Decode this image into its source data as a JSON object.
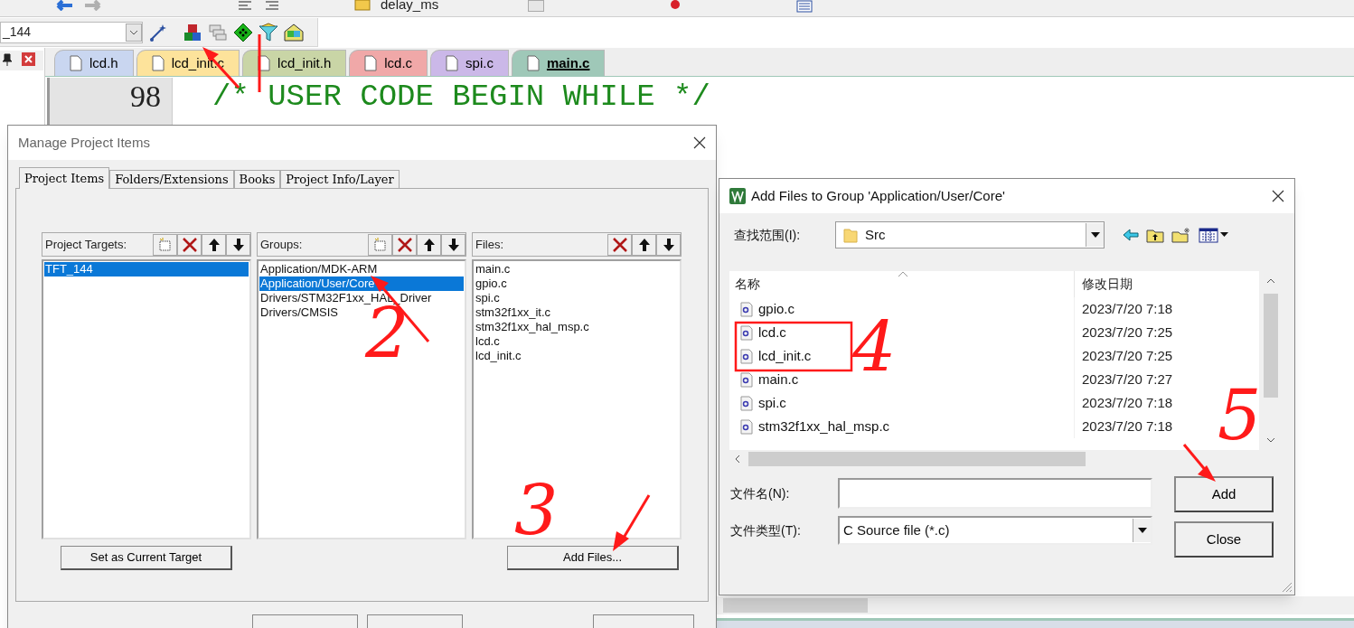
{
  "toolbar": {
    "function_box": "delay_ms",
    "target_box": "_144"
  },
  "tabs": [
    {
      "label": "lcd.h",
      "color": "#c9d6f0",
      "selected": false
    },
    {
      "label": "lcd_init.c",
      "color": "#fde39b",
      "selected": false
    },
    {
      "label": "lcd_init.h",
      "color": "#c9d5a6",
      "selected": false
    },
    {
      "label": "lcd.c",
      "color": "#f0a8a8",
      "selected": false
    },
    {
      "label": "spi.c",
      "color": "#cbb8e8",
      "selected": false
    },
    {
      "label": "main.c",
      "color": "#9fc8b8",
      "selected": true
    }
  ],
  "editor": {
    "lines": [
      {
        "number": "98",
        "code": "/* USER CODE BEGIN WHILE */",
        "kind": "comment"
      }
    ]
  },
  "manage_dialog": {
    "title": "Manage Project Items",
    "tabs": [
      {
        "label": "Project Items",
        "selected": true
      },
      {
        "label": "Folders/Extensions",
        "selected": false
      },
      {
        "label": "Books",
        "selected": false
      },
      {
        "label": "Project Info/Layer",
        "selected": false
      }
    ],
    "panels": [
      {
        "label": "Project Targets:",
        "has_new": true,
        "items": [
          {
            "label": "TFT_144",
            "selected": true
          }
        ]
      },
      {
        "label": "Groups:",
        "has_new": true,
        "items": [
          {
            "label": "Application/MDK-ARM",
            "selected": false
          },
          {
            "label": "Application/User/Core",
            "selected": true
          },
          {
            "label": "Drivers/STM32F1xx_HAL_Driver",
            "selected": false
          },
          {
            "label": "Drivers/CMSIS",
            "selected": false
          }
        ]
      },
      {
        "label": "Files:",
        "has_new": false,
        "items": [
          {
            "label": "main.c",
            "selected": false
          },
          {
            "label": "gpio.c",
            "selected": false
          },
          {
            "label": "spi.c",
            "selected": false
          },
          {
            "label": "stm32f1xx_it.c",
            "selected": false
          },
          {
            "label": "stm32f1xx_hal_msp.c",
            "selected": false
          },
          {
            "label": "lcd.c",
            "selected": false
          },
          {
            "label": "lcd_init.c",
            "selected": false
          }
        ]
      }
    ],
    "buttons": [
      "Set as Current Target",
      "Add Files..."
    ]
  },
  "add_dialog": {
    "title": "Add Files to Group 'Application/User/Core'",
    "look_in_label": "查找范围(I):",
    "look_in_value": "Src",
    "columns": [
      "名称",
      "修改日期"
    ],
    "rows": [
      {
        "name": "gpio.c",
        "date": "2023/7/20 7:18"
      },
      {
        "name": "lcd.c",
        "date": "2023/7/20 7:25"
      },
      {
        "name": "lcd_init.c",
        "date": "2023/7/20 7:25"
      },
      {
        "name": "main.c",
        "date": "2023/7/20 7:27"
      },
      {
        "name": "spi.c",
        "date": "2023/7/20 7:18"
      },
      {
        "name": "stm32f1xx_hal_msp.c",
        "date": "2023/7/20 7:18"
      }
    ],
    "file_name_label": "文件名(N):",
    "file_type_label": "文件类型(T):",
    "file_type_value": "C Source file (*.c)",
    "buttons": [
      "Add",
      "Close"
    ]
  },
  "annotations": [
    "2",
    "3",
    "4",
    "5"
  ]
}
